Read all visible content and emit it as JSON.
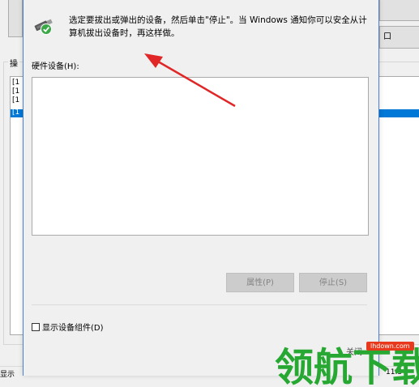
{
  "background": {
    "group_label": "操",
    "right_button_label": "口",
    "list_rows": [
      "[1",
      "[1",
      "[1"
    ],
    "selected_row": "[1",
    "status_left": "显示",
    "status_right": "11:5"
  },
  "dialog": {
    "instruction": "选定要拔出或弹出的设备，然后单击\"停止\"。当 Windows 通知你可以安全从计算机拔出设备时，再这样做。",
    "hardware_label": "硬件设备(H):",
    "properties_button": "属性(P)",
    "stop_button": "停止(S)",
    "show_components_label": "显示设备组件(D)",
    "close_button": "关闭"
  },
  "watermark": {
    "url": "lhdown.com",
    "brand": "领航下载"
  },
  "colors": {
    "selection": "#0078d7",
    "arrow": "#e02626",
    "watermark_green": "#27a832",
    "usb_check": "#39a845"
  },
  "icons": {
    "usb_safe_remove": "usb-drive-check-icon",
    "annotation": "red-arrow"
  }
}
